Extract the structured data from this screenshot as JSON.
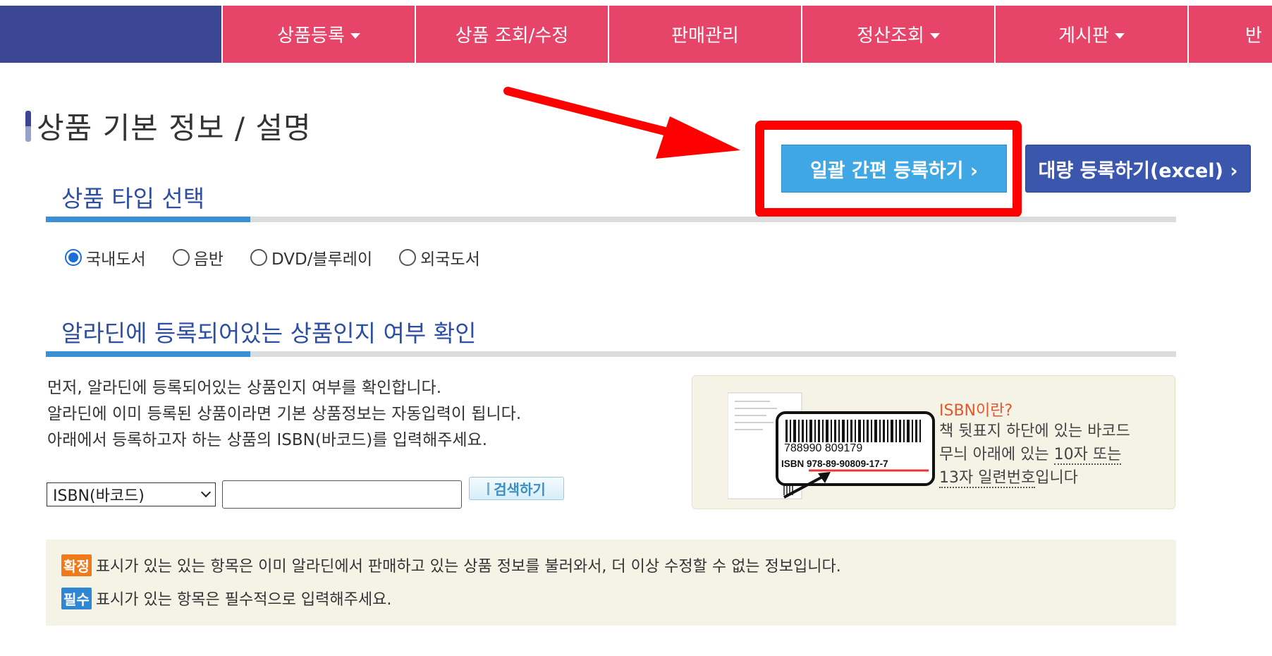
{
  "nav": {
    "items": [
      {
        "label": "상품등록",
        "has_caret": true
      },
      {
        "label": "상품 조회/수정",
        "has_caret": false
      },
      {
        "label": "판매관리",
        "has_caret": false
      },
      {
        "label": "정산조회",
        "has_caret": true
      },
      {
        "label": "게시판",
        "has_caret": true
      },
      {
        "label": "반",
        "has_caret": false
      }
    ],
    "colors": {
      "brand": "#3b4693",
      "menu": "#e74469"
    }
  },
  "page_title": "상품 기본 정보 / 설명",
  "buttons": {
    "quick_register": "일괄 간편 등록하기 ›",
    "bulk_register": "대량 등록하기(excel) ›"
  },
  "highlight_color": "#ff0000",
  "section_type": {
    "title": "상품 타입 선택",
    "options": [
      {
        "label": "국내도서",
        "checked": true
      },
      {
        "label": "음반",
        "checked": false
      },
      {
        "label": "DVD/블루레이",
        "checked": false
      },
      {
        "label": "외국도서",
        "checked": false
      }
    ]
  },
  "section_check": {
    "title": "알라딘에 등록되어있는 상품인지 여부 확인",
    "description": [
      "먼저, 알라딘에 등록되어있는 상품인지 여부를 확인합니다.",
      "알라딘에 이미 등록된 상품이라면 기본 상품정보는 자동입력이 됩니다.",
      "아래에서 등록하고자 하는 상품의 ISBN(바코드)를 입력해주세요."
    ],
    "search": {
      "select_value": "ISBN(바코드)",
      "input_value": "",
      "button_label": "검색하기"
    },
    "isbn_info": {
      "title": "ISBN이란?",
      "line1": "책 뒷표지 하단에 있는 바코드",
      "line2_pre": "무늬 아래에 있는 ",
      "line2_dotted": "10자 또는",
      "line3_dotted": "13자 일련번호",
      "line3_post": "입니다",
      "barcode_digits": "788990 809179",
      "isbn_number": "ISBN 978-89-90809-17-7"
    }
  },
  "notice": {
    "confirmed_badge": "확정",
    "confirmed_text": "표시가 있는 있는 항목은 이미 알라딘에서 판매하고 있는 상품 정보를 불러와서, 더 이상 수정할 수 없는 정보입니다.",
    "required_badge": "필수",
    "required_text": "표시가 있는 항목은 필수적으로 입력해주세요."
  }
}
